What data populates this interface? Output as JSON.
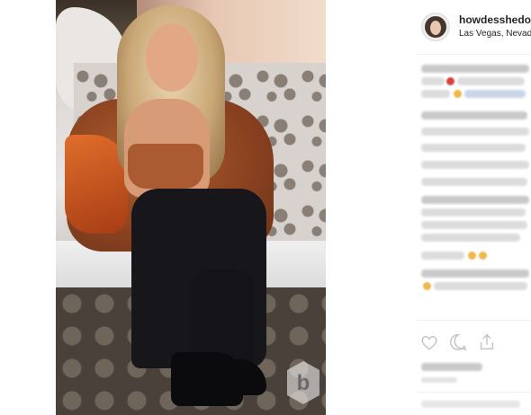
{
  "post": {
    "username": "howdesshedoit",
    "location": "Las Vegas, Nevada",
    "watermark_letter": "b"
  },
  "icons": {
    "like": "heart-icon",
    "comment": "comment-icon",
    "share": "share-icon",
    "watermark": "b-logo-icon"
  },
  "colors": {
    "accent_emoji_red": "#d9433b",
    "emoji_yellow": "#f0b74a",
    "link_blue": "#c8d6e8"
  }
}
